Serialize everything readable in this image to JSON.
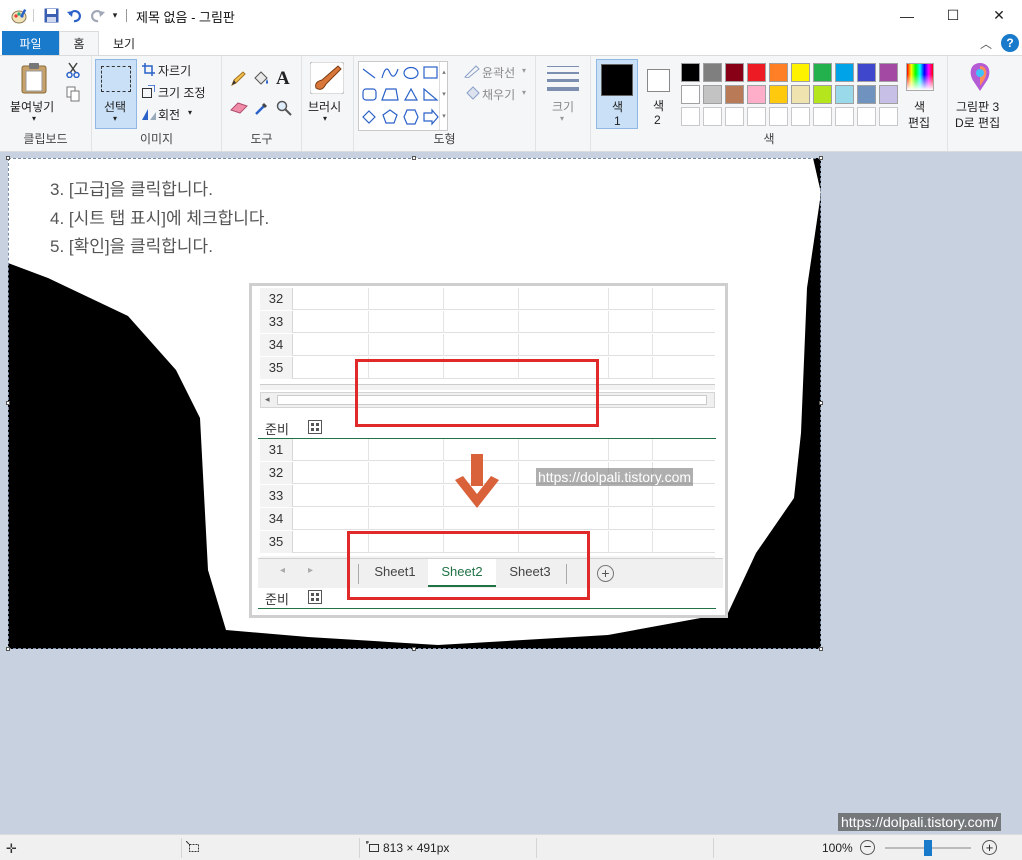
{
  "window": {
    "title": "제목 없음 - 그림판",
    "minimize": "—",
    "maximize": "☐",
    "close": "✕"
  },
  "tabs": {
    "file": "파일",
    "home": "홈",
    "view": "보기"
  },
  "ribbon": {
    "clipboard": {
      "paste": "붙여넣기",
      "group": "클립보드"
    },
    "image": {
      "select": "선택",
      "crop": "자르기",
      "resize": "크기 조정",
      "rotate": "회전",
      "group": "이미지"
    },
    "tools": {
      "group": "도구"
    },
    "brushes": {
      "label": "브러시"
    },
    "shapes": {
      "outline": "윤곽선",
      "fill": "채우기",
      "group": "도형"
    },
    "size": {
      "label": "크기"
    },
    "colors": {
      "color1_label": "색",
      "color1_num": "1",
      "color2_label": "색",
      "color2_num": "2",
      "edit_line1": "색",
      "edit_line2": "편집",
      "group": "색",
      "color1": "#000000",
      "color2": "#ffffff",
      "palette_row1": [
        "#000000",
        "#7f7f7f",
        "#880015",
        "#ed1c24",
        "#ff7f27",
        "#fff200",
        "#22b14c",
        "#00a2e8",
        "#3f48cc",
        "#a349a4"
      ],
      "palette_row2": [
        "#ffffff",
        "#c3c3c3",
        "#b97a57",
        "#ffaec9",
        "#ffc90e",
        "#efe4b0",
        "#b5e61d",
        "#99d9ea",
        "#7092be",
        "#c8bfe7"
      ]
    },
    "paint3d": {
      "line1": "그림판 3",
      "line2": "D로 편집"
    }
  },
  "canvas_content": {
    "steps": [
      "3. [고급]을 클릭합니다.",
      "4. [시트 탭 표시]에 체크합니다.",
      "5. [확인]을 클릭합니다."
    ],
    "top_rows": [
      "32",
      "33",
      "34",
      "35"
    ],
    "bottom_rows": [
      "31",
      "32",
      "33",
      "34",
      "35"
    ],
    "status_ready": "준비",
    "sheets": [
      "Sheet1",
      "Sheet2",
      "Sheet3"
    ],
    "watermark": "https://dolpali.tistory.com"
  },
  "statusbar": {
    "dimensions": "813 × 491px",
    "zoom": "100%",
    "zoom_level": 1.0
  },
  "watermark": "https://dolpali.tistory.com/"
}
